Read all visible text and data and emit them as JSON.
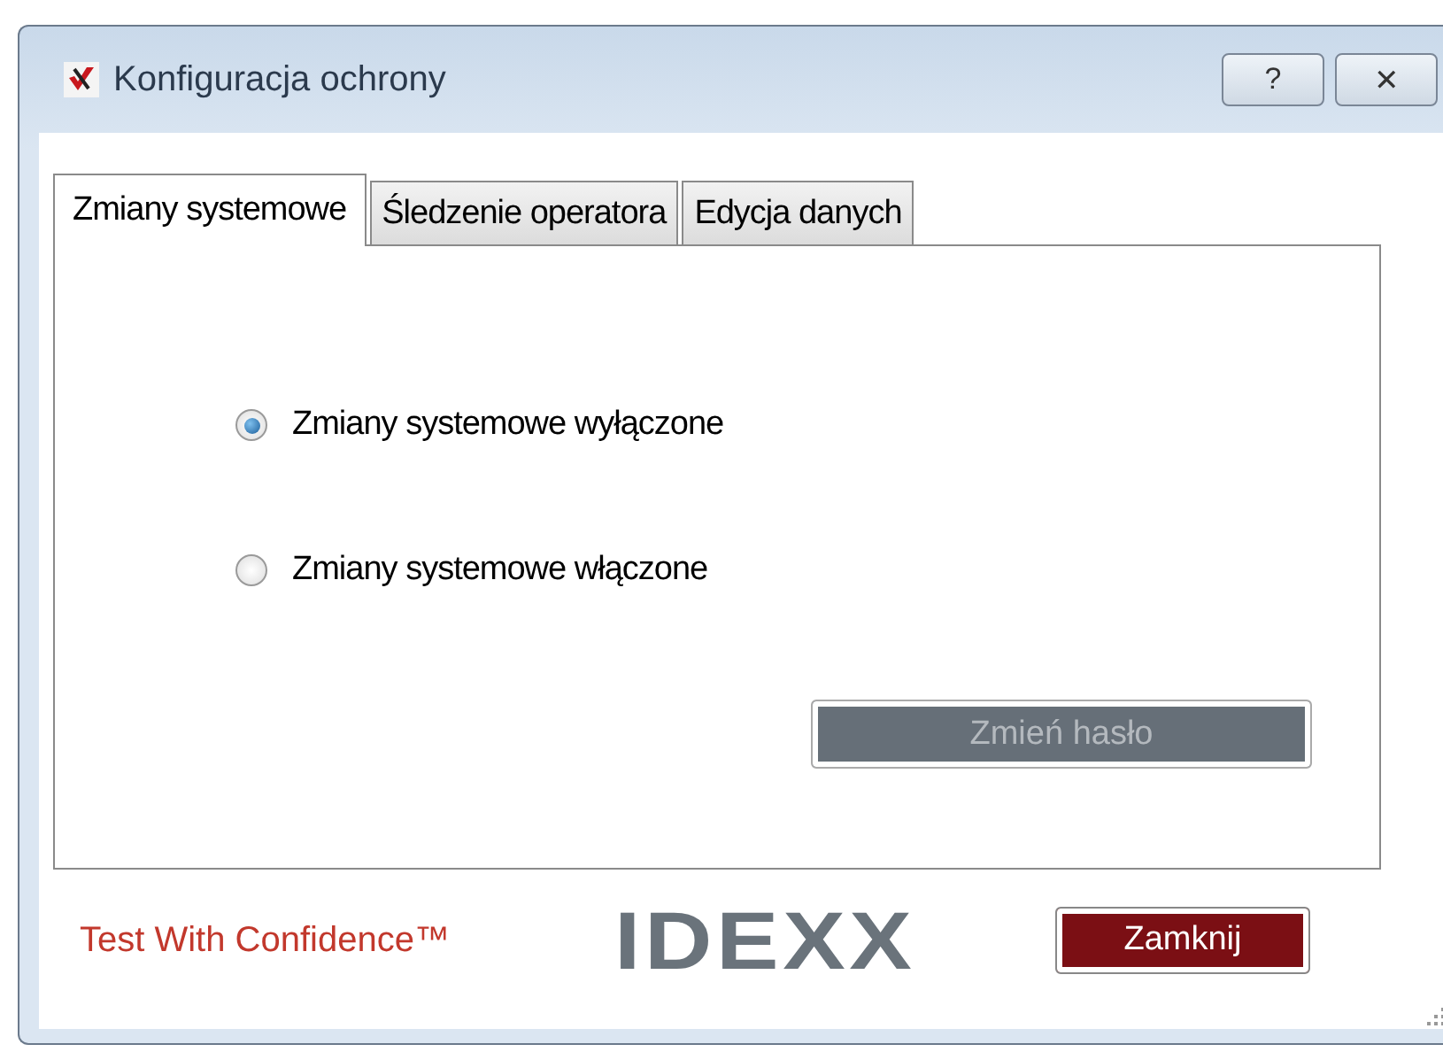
{
  "window": {
    "title": "Konfiguracja ochrony",
    "buttons": [
      {
        "label": "?"
      },
      {
        "label": "✕"
      }
    ]
  },
  "tabs": [
    {
      "label": "Zmiany systemowe",
      "selected": true
    },
    {
      "label": "Śledzenie operatora",
      "selected": false
    },
    {
      "label": "Edycja danych",
      "selected": false
    }
  ],
  "options": [
    {
      "label": "Zmiany systemowe wyłączone",
      "selected": true
    },
    {
      "label": "Zmiany systemowe włączone",
      "selected": false
    }
  ],
  "change_password_button": {
    "label": "Zmień hasło",
    "disabled": true
  },
  "footer": {
    "tagline": "Test With Confidence™",
    "logo": "IDEXX",
    "close_button": "Zamknij"
  }
}
